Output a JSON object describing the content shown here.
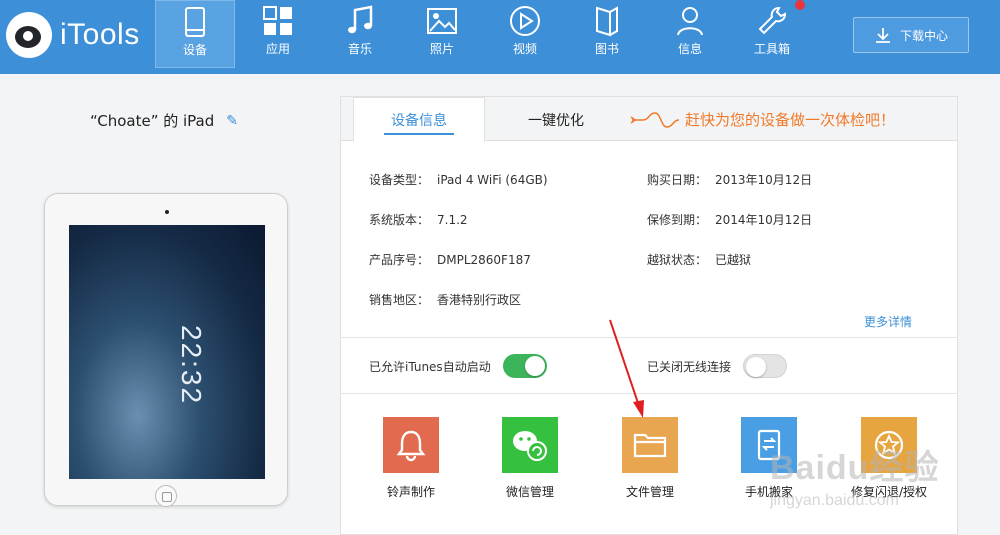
{
  "app": {
    "name": "iTools"
  },
  "nav": [
    {
      "id": "device",
      "label": "设备",
      "icon": "tablet-icon",
      "active": true
    },
    {
      "id": "apps",
      "label": "应用",
      "icon": "grid-icon"
    },
    {
      "id": "music",
      "label": "音乐",
      "icon": "music-note-icon"
    },
    {
      "id": "photos",
      "label": "照片",
      "icon": "image-icon"
    },
    {
      "id": "video",
      "label": "视频",
      "icon": "play-icon"
    },
    {
      "id": "books",
      "label": "图书",
      "icon": "book-icon"
    },
    {
      "id": "info",
      "label": "信息",
      "icon": "person-icon"
    },
    {
      "id": "tools",
      "label": "工具箱",
      "icon": "wrench-icon"
    }
  ],
  "download_center": {
    "label": "下载中心"
  },
  "device": {
    "name": "“Choate” 的 iPad",
    "lock_time": "22:32"
  },
  "tabs": {
    "device_info": "设备信息",
    "optimize": "一键优化",
    "promo": "赶快为您的设备做一次体检吧！"
  },
  "info": {
    "left": [
      {
        "key": "设备类型：",
        "value": "iPad 4 WiFi  (64GB)"
      },
      {
        "key": "系统版本：",
        "value": "7.1.2"
      },
      {
        "key": "产品序号：",
        "value": "DMPL2860F187"
      },
      {
        "key": "销售地区：",
        "value": "香港特别行政区"
      }
    ],
    "right": [
      {
        "key": "购买日期：",
        "value": "2013年10月12日"
      },
      {
        "key": "保修到期：",
        "value": "2014年10月12日"
      },
      {
        "key": "越狱状态：",
        "value": "已越狱"
      }
    ],
    "more": "更多详情"
  },
  "toggles": {
    "itunes": {
      "label": "已允许iTunes自动启动",
      "on": true
    },
    "wireless": {
      "label": "已关闭无线连接",
      "on": false
    }
  },
  "tools": [
    {
      "label": "铃声制作",
      "icon": "bell-icon",
      "color": "#e26a4f"
    },
    {
      "label": "微信管理",
      "icon": "wechat-icon",
      "color": "#35c13f"
    },
    {
      "label": "文件管理",
      "icon": "folder-icon",
      "color": "#e9a650"
    },
    {
      "label": "手机搬家",
      "icon": "phone-transfer-icon",
      "color": "#4a9ee4"
    },
    {
      "label": "修复闪退/授权",
      "icon": "star-badge-icon",
      "color": "#e6a53e"
    }
  ],
  "watermark": {
    "text": "Baidu经验",
    "sub": "jingyan.baidu.com"
  },
  "colors": {
    "brand": "#3d8fd8",
    "accent": "#f17a2a",
    "switch_on": "#3cb45a"
  }
}
